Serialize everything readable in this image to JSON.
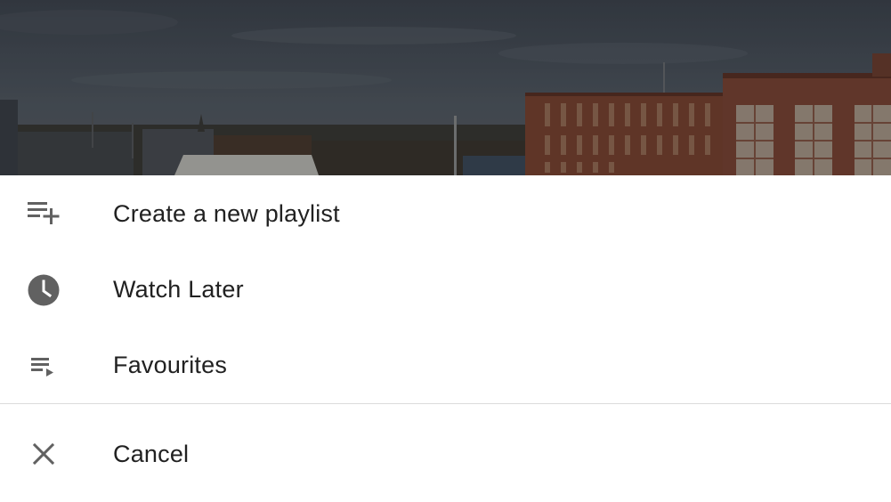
{
  "sheet": {
    "items": [
      {
        "label": "Create a new playlist",
        "icon": "playlist-add-icon"
      },
      {
        "label": "Watch Later",
        "icon": "clock-icon"
      },
      {
        "label": "Favourites",
        "icon": "playlist-play-icon"
      }
    ],
    "cancel": {
      "label": "Cancel",
      "icon": "close-icon"
    }
  },
  "colors": {
    "text": "#212121",
    "icon": "#616161",
    "divider": "#dcdcdc",
    "background": "#ffffff"
  }
}
